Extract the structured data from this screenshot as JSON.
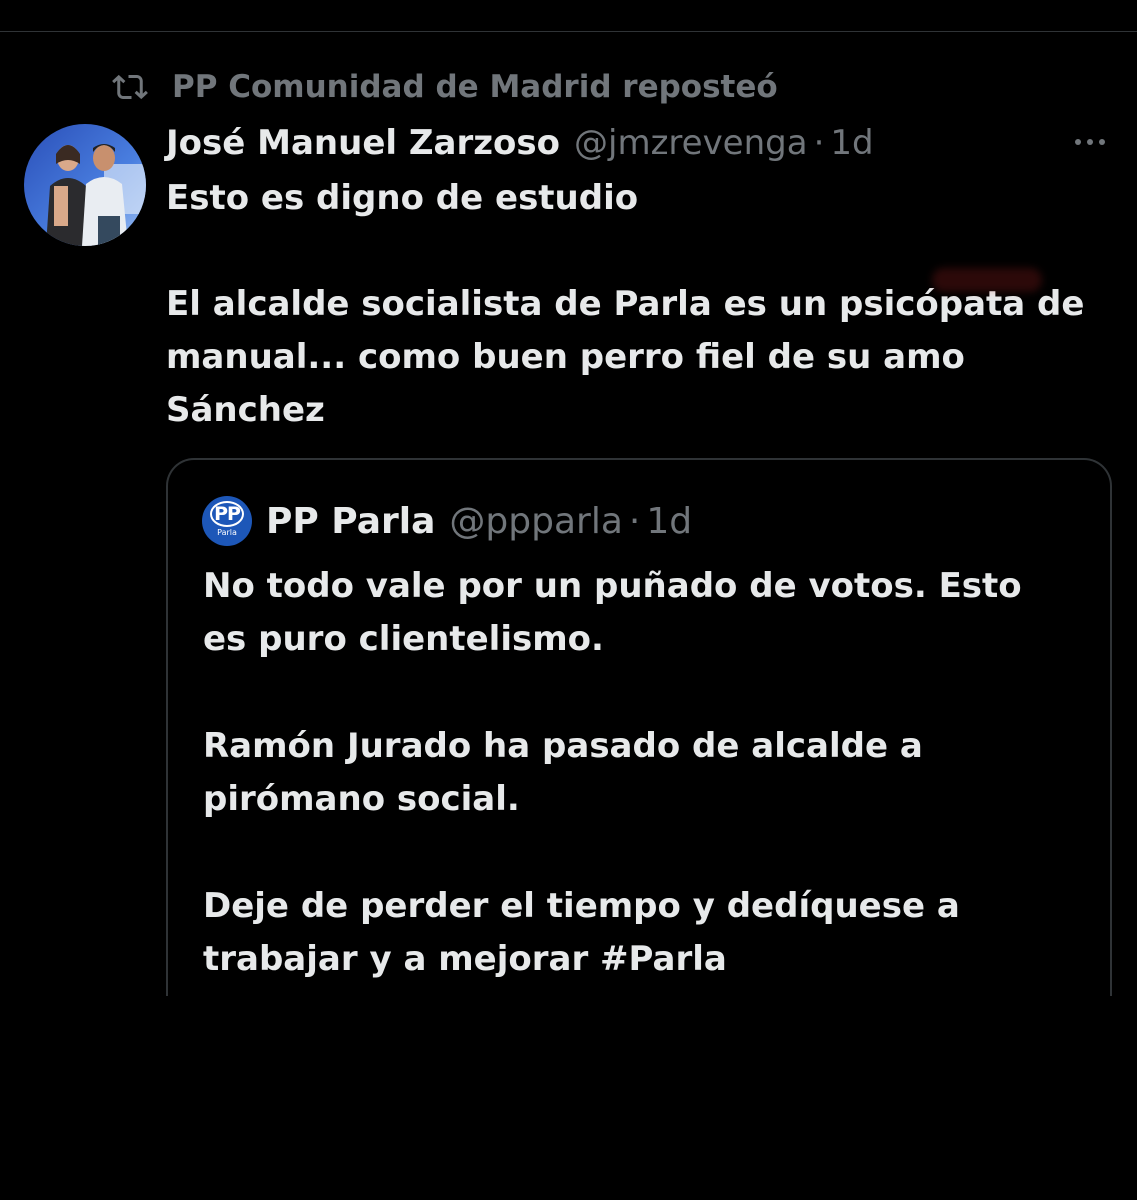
{
  "repost": {
    "label": "PP Comunidad de Madrid reposteó",
    "icon": "repost-icon"
  },
  "tweet": {
    "author_name": "José Manuel Zarzoso",
    "author_handle": "@jmzrevenga",
    "separator": "·",
    "time": "1d",
    "text_line1": "Esto es digno de estudio",
    "text_para2_line1": "El alcalde socialista de Parla es un psicópata de",
    "text_para2_line2": "manual... como buen perro fiel de su amo",
    "text_para2_line3": "Sánchez",
    "more_icon": "more-horizontal-icon"
  },
  "quote": {
    "author_name": "PP Parla",
    "author_handle": "@ppparla",
    "separator": "·",
    "time": "1d",
    "avatar_text": "PP",
    "avatar_subtext": "Parla",
    "para1_line1": "No todo vale por un puñado de votos. Esto",
    "para1_line2": "es puro clientelismo.",
    "para2_line1": "Ramón Jurado ha pasado de alcalde a",
    "para2_line2": "pirómano social.",
    "para3_line1": "Deje de perder el tiempo y dedíquese a",
    "para3_line2": "trabajar y a mejorar #Parla"
  },
  "colors": {
    "background": "#000000",
    "primary_text": "#e7e9ea",
    "secondary_text": "#71767b",
    "border": "#2f3336",
    "pp_blue": "#1d57b8"
  }
}
